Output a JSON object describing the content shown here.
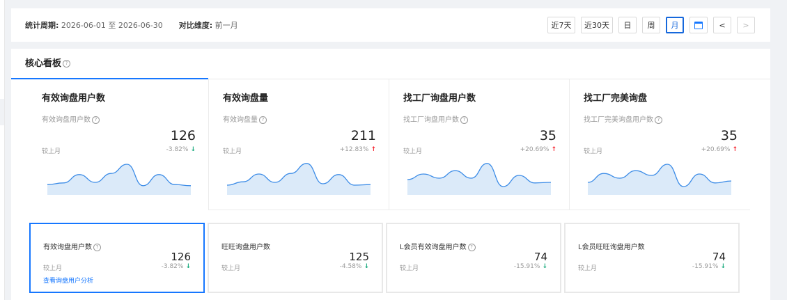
{
  "filter": {
    "period_label": "统计周期:",
    "period_value": "2026-06-01 至 2026-06-30",
    "compare_label": "对比维度:",
    "compare_value": "前一月",
    "buttons": [
      "近7天",
      "近30天",
      "日",
      "周",
      "月"
    ],
    "active": "月"
  },
  "dashboard": {
    "title": "核心看板",
    "kpis": [
      {
        "title": "有效询盘用户数",
        "subtitle": "有效询盘用户数",
        "value": "126",
        "compare_label": "较上月",
        "change": "-3.82%",
        "direction": "down",
        "trend": [
          0.22,
          0.28,
          0.58,
          0.3,
          0.62,
          0.95,
          0.18,
          0.58,
          0.22,
          0.18
        ]
      },
      {
        "title": "有效询盘量",
        "subtitle": "有效询盘量",
        "value": "211",
        "compare_label": "较上月",
        "change": "+12.83%",
        "direction": "up",
        "trend": [
          0.2,
          0.32,
          0.6,
          0.3,
          0.62,
          0.98,
          0.25,
          0.58,
          0.2,
          0.22
        ]
      },
      {
        "title": "找工厂询盘用户数",
        "subtitle": "找工厂询盘用户数",
        "value": "35",
        "compare_label": "较上月",
        "change": "+20.69%",
        "direction": "up",
        "trend": [
          0.4,
          0.6,
          0.45,
          0.72,
          0.45,
          0.98,
          0.15,
          0.55,
          0.28,
          0.3
        ]
      },
      {
        "title": "找工厂完美询盘",
        "subtitle": "找工厂完美询盘用户数",
        "value": "35",
        "compare_label": "较上月",
        "change": "+20.69%",
        "direction": "up",
        "trend": [
          0.3,
          0.62,
          0.45,
          0.72,
          0.55,
          0.95,
          0.15,
          0.6,
          0.28,
          0.35
        ]
      }
    ],
    "subcards": [
      {
        "title": "有效询盘用户数",
        "value": "126",
        "compare_label": "较上月",
        "change": "-3.82%",
        "direction": "down",
        "link": "查看询盘用户分析",
        "help": true
      },
      {
        "title": "旺旺询盘用户数",
        "value": "125",
        "compare_label": "较上月",
        "change": "-4.58%",
        "direction": "down",
        "help": false
      },
      {
        "title": "L会员有效询盘用户数",
        "value": "74",
        "compare_label": "较上月",
        "change": "-15.91%",
        "direction": "down",
        "help": true
      },
      {
        "title": "L会员旺旺询盘用户数",
        "value": "74",
        "compare_label": "较上月",
        "change": "-15.91%",
        "direction": "down",
        "help": false
      }
    ]
  },
  "colors": {
    "accent": "#1677ff",
    "down": "#13a87a",
    "up": "#f5222d",
    "spark_fill": "#dbeaf9",
    "spark_line": "#3c8ce7"
  },
  "icons": {
    "down": "↓",
    "up": "↑",
    "prev": "<",
    "next": ">"
  }
}
